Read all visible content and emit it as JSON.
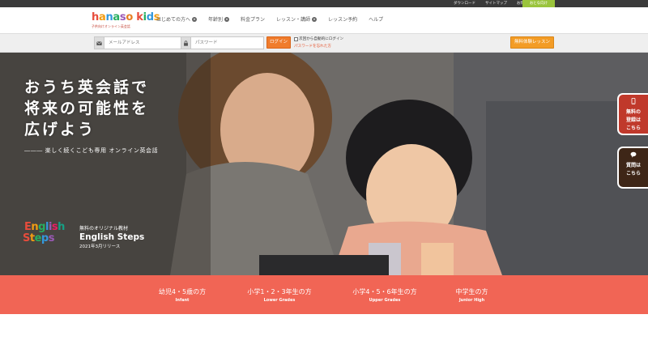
{
  "utility_bar": {
    "links": [
      "ダウンロード",
      "サイトマップ",
      "お問合せ"
    ],
    "adult_button": "おとな向け"
  },
  "logo": {
    "text": "hanaso kids",
    "letters": [
      "h",
      "a",
      "n",
      "a",
      "s",
      "o",
      " ",
      "k",
      "i",
      "d",
      "s"
    ],
    "letter_colors": [
      "#e74c3c",
      "#f39c12",
      "#3498db",
      "#27ae60",
      "#9b59b6",
      "#e67e22",
      "",
      "#e74c3c",
      "#27ae60",
      "#3498db",
      "#f39c12"
    ],
    "subtitle": "子供向けオンライン英会話"
  },
  "nav": {
    "items": [
      {
        "label": "はじめての方へ",
        "dropdown": true
      },
      {
        "label": "年齢別",
        "dropdown": true
      },
      {
        "label": "料金プラン",
        "dropdown": false
      },
      {
        "label": "レッスン・講師",
        "dropdown": true
      },
      {
        "label": "レッスン予約",
        "dropdown": false
      },
      {
        "label": "ヘルプ",
        "dropdown": false
      }
    ]
  },
  "login": {
    "email_placeholder": "メールアドレス",
    "password_placeholder": "パスワード",
    "login_button": "ログイン",
    "remember_label": "次回から自動的にログイン",
    "forgot_link": "パスワードを忘れた方",
    "trial_button": "無料体験レッスン"
  },
  "hero": {
    "headline_lines": [
      "おうち英会話で",
      "将来の可能性を",
      "広げよう"
    ],
    "tagline": "―――  楽しく続くこども専用 オンライン英会話",
    "english_steps": {
      "logo_line1": "English",
      "logo_line2": "Steps",
      "intro": "無料のオリジナル教材",
      "title": "English Steps",
      "release": "2021年3月リリース"
    }
  },
  "side_buttons": [
    {
      "label_lines": [
        "無料の",
        "登録は",
        "こちら"
      ],
      "icon": "smartphone-icon"
    },
    {
      "label_lines": [
        "質問は",
        "こちら"
      ],
      "icon": "chat-bubble-icon"
    }
  ],
  "grades": [
    {
      "jp": "幼児4・5歳の方",
      "en": "Infant"
    },
    {
      "jp": "小学1・2・3年生の方",
      "en": "Lower Grades"
    },
    {
      "jp": "小学4・5・6年生の方",
      "en": "Upper Grades"
    },
    {
      "jp": "中学生の方",
      "en": "Junior High"
    }
  ],
  "colors": {
    "accent_orange": "#f07c2c",
    "grades_band": "#f16555",
    "adult_green": "#9ac43c",
    "side_red": "#c0392b",
    "side_brown": "#3e2617"
  }
}
